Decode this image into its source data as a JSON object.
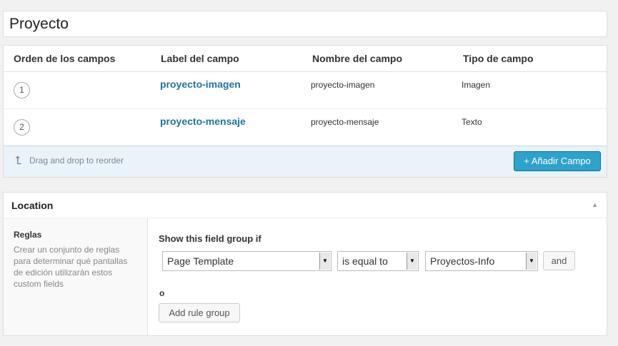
{
  "post_title": "Proyecto",
  "fields_table": {
    "headers": [
      "Orden de los campos",
      "Label del campo",
      "Nombre del campo",
      "Tipo de campo"
    ],
    "rows": [
      {
        "order": "1",
        "label": "proyecto-imagen",
        "name": "proyecto-imagen",
        "type": "Imagen"
      },
      {
        "order": "2",
        "label": "proyecto-mensaje",
        "name": "proyecto-mensaje",
        "type": "Texto"
      }
    ],
    "drag_hint": "Drag and drop to reorder",
    "add_button": "+ Añadir Campo"
  },
  "location": {
    "title": "Location",
    "rules_title": "Reglas",
    "rules_description": "Crear un conjunto de reglas para determinar qué pantallas de edición utilizarán estos custom fields",
    "show_if_label": "Show this field group if",
    "param_select": "Page Template",
    "operator_select": "is equal to",
    "value_select": "Proyectos-Info",
    "and_button": "and",
    "or_label": "o",
    "add_rule_group_button": "Add rule group"
  },
  "colors": {
    "accent": "#2ea2cc",
    "link": "#21759b",
    "footer_bg": "#eaf2fa"
  },
  "icons": {
    "drag": "curved-up-arrow-icon",
    "collapse": "triangle-up-icon"
  }
}
